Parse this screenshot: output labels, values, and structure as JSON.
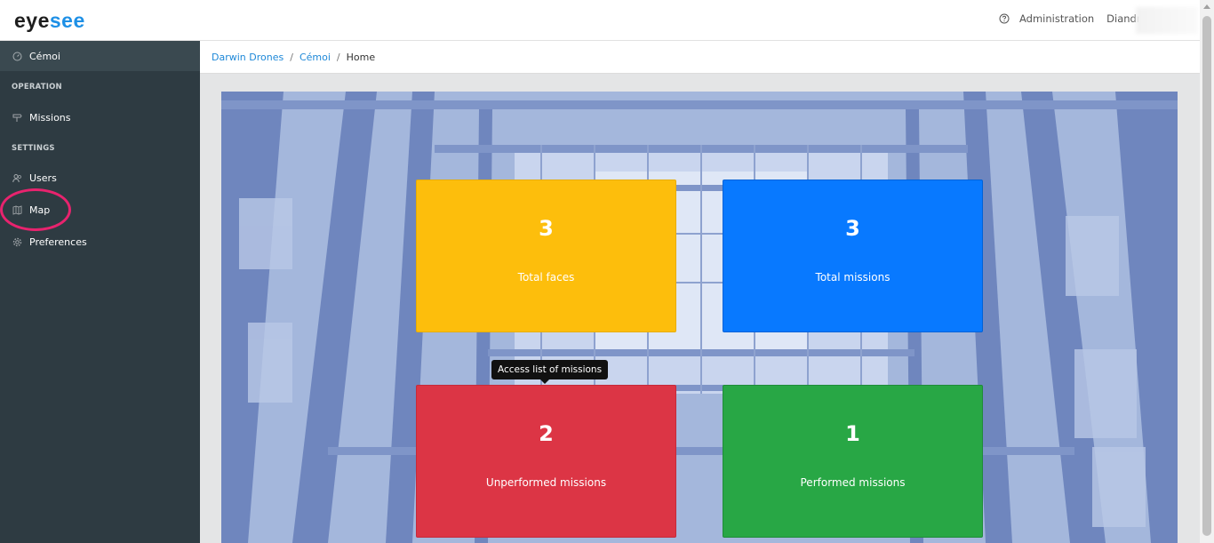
{
  "header": {
    "logo_part1": "eye",
    "logo_part2": "see",
    "help_icon": "question-circle-icon",
    "administration": "Administration",
    "user_name": "Diandra G"
  },
  "sidebar": {
    "site": "Cémoi",
    "operation_heading": "OPERATION",
    "missions": "Missions",
    "settings_heading": "SETTINGS",
    "users": "Users",
    "map": "Map",
    "preferences": "Preferences",
    "colors": {
      "background": "#2e3b42",
      "highlight_ring": "#e8236e"
    }
  },
  "breadcrumb": {
    "items": [
      "Darwin Drones",
      "Cémoi"
    ],
    "separator": "/",
    "current": "Home"
  },
  "cards": [
    {
      "value": "3",
      "label": "Total faces",
      "color": "#fdbe0c"
    },
    {
      "value": "3",
      "label": "Total missions",
      "color": "#0879ff"
    },
    {
      "value": "2",
      "label": "Unperformed missions",
      "color": "#dc3545"
    },
    {
      "value": "1",
      "label": "Performed missions",
      "color": "#28a745"
    }
  ],
  "tooltip": "Access list of missions"
}
